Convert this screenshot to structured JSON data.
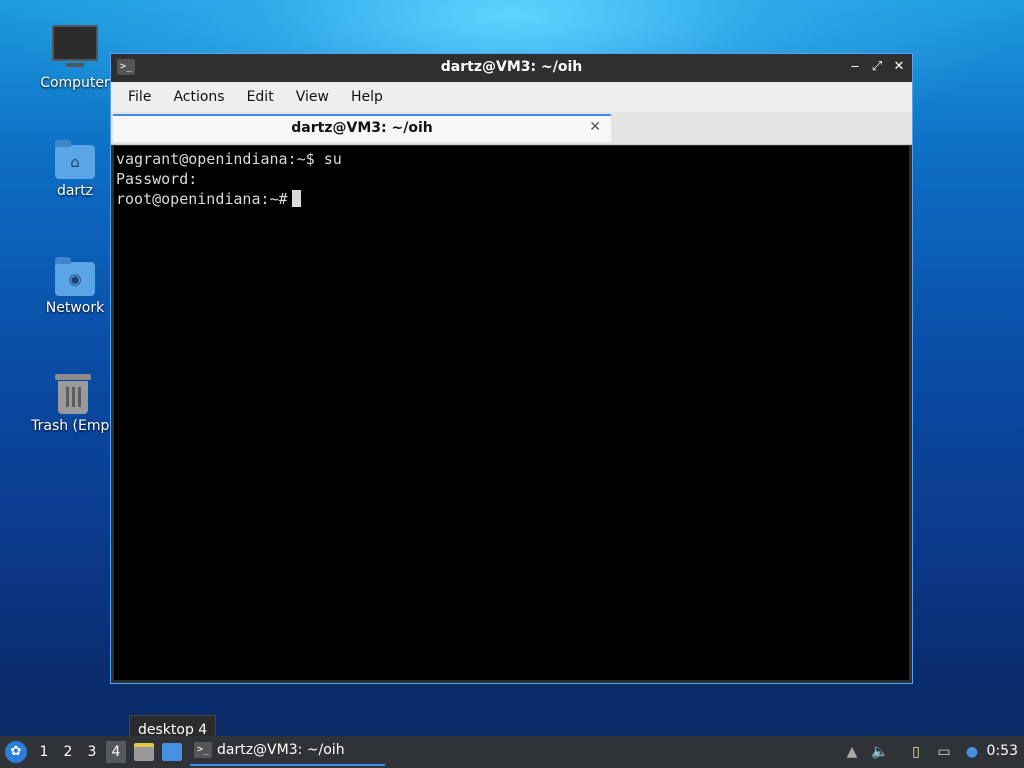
{
  "desktop": {
    "icons": [
      {
        "label": "Computer"
      },
      {
        "label": "dartz"
      },
      {
        "label": "Network"
      },
      {
        "label": "Trash (Empt"
      }
    ]
  },
  "window": {
    "title": "dartz@VM3: ~/oih",
    "app_icon": ">_",
    "controls": {
      "minimize": "‒",
      "maximize": "⤢",
      "close": "✕"
    },
    "menu": [
      "File",
      "Actions",
      "Edit",
      "View",
      "Help"
    ],
    "tab": {
      "title": "dartz@VM3: ~/oih",
      "close": "✕"
    },
    "terminal_lines": [
      "vagrant@openindiana:~$ su",
      "Password:",
      "root@openindiana:~#"
    ]
  },
  "tooltip": "desktop 4",
  "panel": {
    "start_icon": "menu-icon",
    "workspaces": [
      "1",
      "2",
      "3",
      "4"
    ],
    "active_workspace": "4",
    "task": {
      "label": "dartz@VM3: ~/oih",
      "icon": ">_"
    },
    "clock": "0:53"
  },
  "colors": {
    "accent": "#3b8cf0",
    "panel": "#2f3236",
    "terminal_bg": "#000000"
  }
}
